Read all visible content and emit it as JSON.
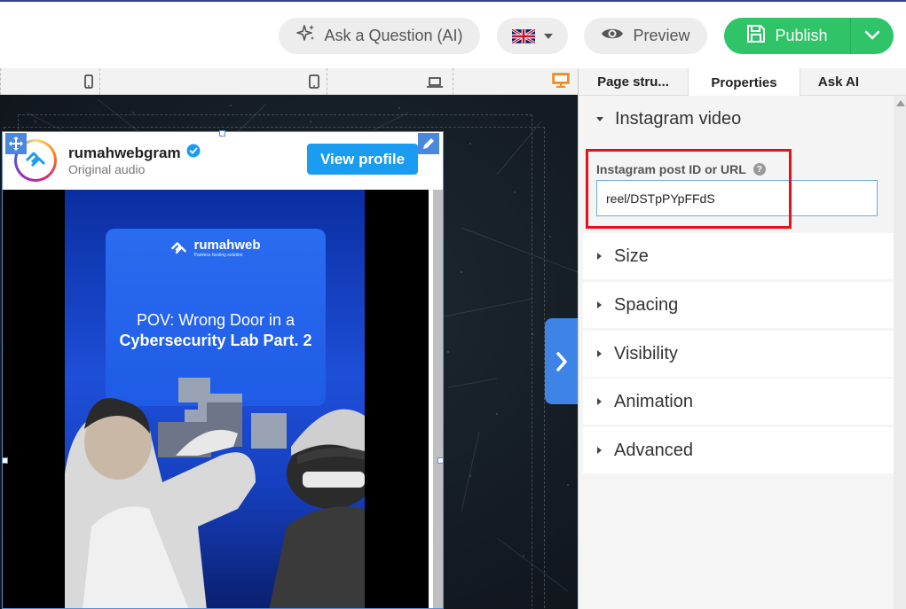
{
  "topbar": {
    "ask_label": "Ask a Question (AI)",
    "language_flag": "uk-flag-icon",
    "preview_label": "Preview",
    "publish_label": "Publish",
    "publish_color": "#2ec467"
  },
  "devices": {
    "icons": [
      "mobile-icon",
      "tablet-icon",
      "laptop-icon",
      "desktop-icon"
    ],
    "active": "desktop-icon",
    "active_color": "#f28a1c"
  },
  "widget": {
    "username": "rumahwebgram",
    "subtitle": "Original audio",
    "view_profile_label": "View profile",
    "poster": {
      "brand": "rumahweb",
      "brand_tagline": "Painless hosting solution",
      "title_line1": "POV: Wrong Door in a",
      "title_line2": "Cybersecurity Lab Part. 2"
    }
  },
  "panel": {
    "tabs": [
      {
        "label": "Page stru..."
      },
      {
        "label": "Properties",
        "active": true
      },
      {
        "label": "Ask AI"
      }
    ],
    "instagram_section": "Instagram video",
    "field_label": "Instagram post ID or URL",
    "field_value": "reel/DSTpPYpFFdS",
    "sections": [
      "Size",
      "Spacing",
      "Visibility",
      "Animation",
      "Advanced"
    ],
    "highlight_color": "#e8101a"
  }
}
